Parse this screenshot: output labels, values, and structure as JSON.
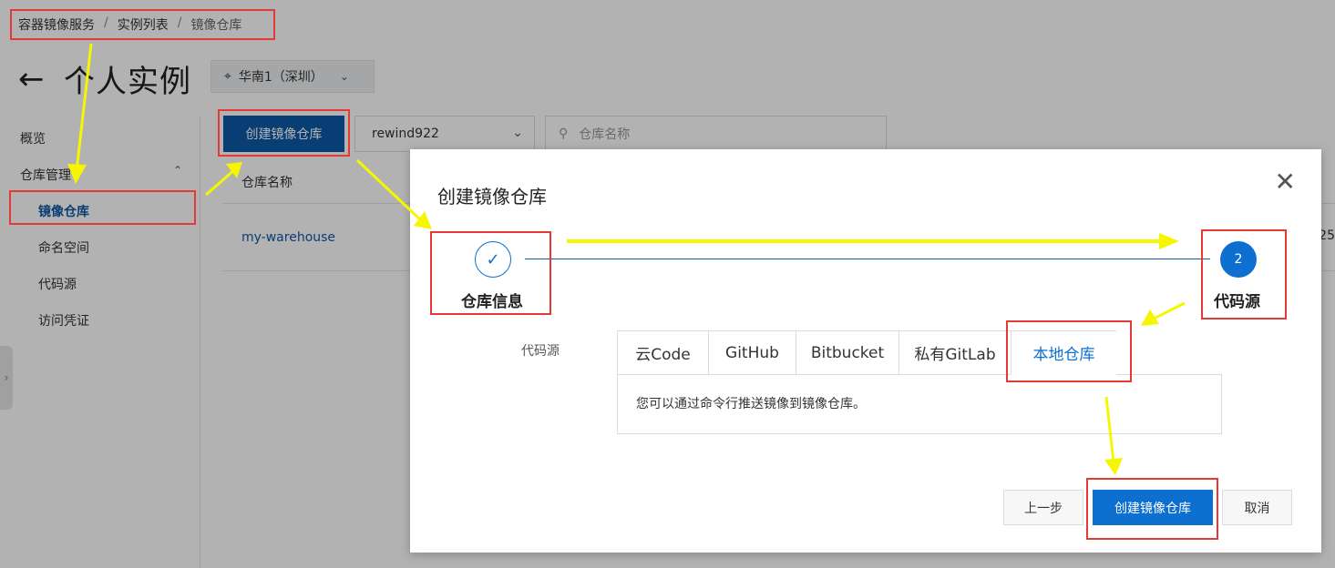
{
  "breadcrumb": [
    "容器镜像服务",
    "实例列表",
    "镜像仓库"
  ],
  "page_title": "个人实例",
  "region": "华南1（深圳）",
  "sidebar": {
    "overview": "概览",
    "repo_mgmt": "仓库管理",
    "items": [
      "镜像仓库",
      "命名空间",
      "代码源",
      "访问凭证"
    ]
  },
  "toolbar": {
    "create_label": "创建镜像仓库",
    "namespace": "rewind922",
    "search_placeholder": "仓库名称"
  },
  "table": {
    "column": "仓库名称",
    "row_name": "my-warehouse",
    "row_tail": "25"
  },
  "modal": {
    "title": "创建镜像仓库",
    "step1_label": "仓库信息",
    "step2_number": "2",
    "step2_label": "代码源",
    "source_label": "代码源",
    "tabs": [
      "云Code",
      "GitHub",
      "Bitbucket",
      "私有GitLab",
      "本地仓库"
    ],
    "active_tab": "本地仓库",
    "panel_text": "您可以通过命令行推送镜像到镜像仓库。",
    "prev_label": "上一步",
    "create_label": "创建镜像仓库",
    "cancel_label": "取消"
  },
  "colors": {
    "primary": "#0d6fcf",
    "highlight": "#e53935",
    "arrow": "#f6f600"
  }
}
